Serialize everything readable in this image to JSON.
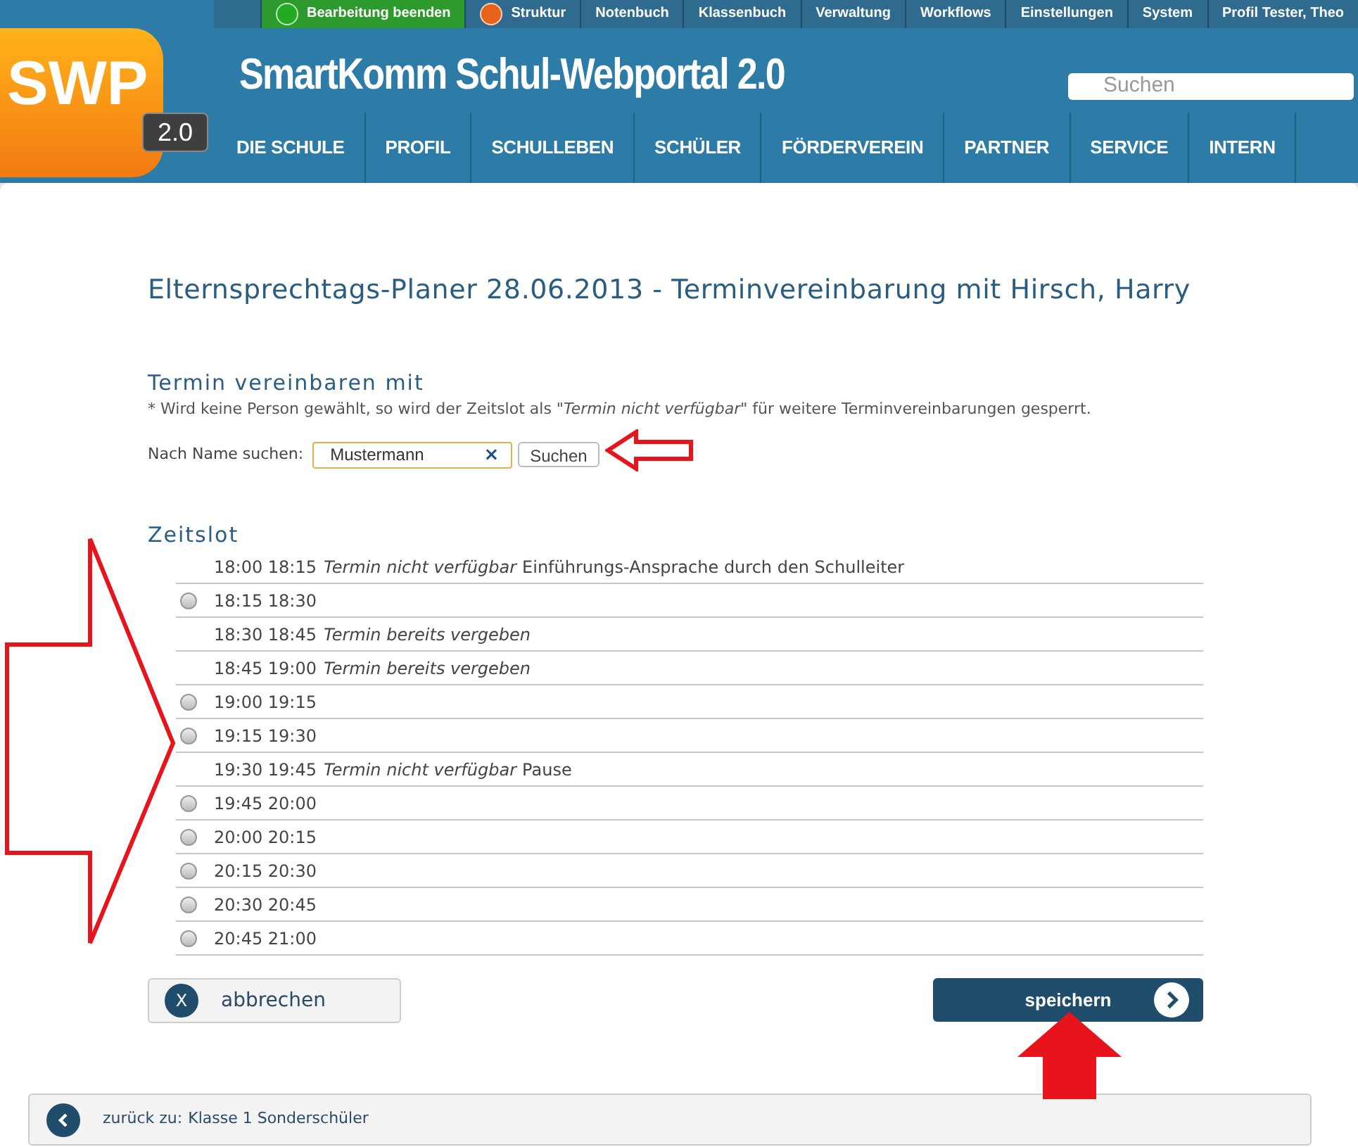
{
  "topbar": [
    {
      "label": "Bearbeitung beenden",
      "kind": "active",
      "color": "#22aa22"
    },
    {
      "label": "Struktur",
      "kind": "dot",
      "color": "#e8621a"
    },
    {
      "label": "Notenbuch",
      "kind": "plain"
    },
    {
      "label": "Klassenbuch",
      "kind": "plain"
    },
    {
      "label": "Verwaltung",
      "kind": "plain"
    },
    {
      "label": "Workflows",
      "kind": "plain"
    },
    {
      "label": "Einstellungen",
      "kind": "plain"
    },
    {
      "label": "System",
      "kind": "plain"
    },
    {
      "label": "Profil Tester, Theo",
      "kind": "plain"
    }
  ],
  "logo": {
    "text": "SWP",
    "version": "2.0"
  },
  "site_title": "SmartKomm Schul-Webportal 2.0",
  "search": {
    "placeholder": "Suchen"
  },
  "nav": [
    "DIE SCHULE",
    "PROFIL",
    "SCHULLEBEN",
    "SCHÜLER",
    "FÖRDERVEREIN",
    "PARTNER",
    "SERVICE",
    "INTERN"
  ],
  "page_title": "Elternsprechtags-Planer 28.06.2013 - Terminvereinbarung mit Hirsch, Harry",
  "appointment": {
    "heading": "Termin vereinbaren mit",
    "note": "* Wird keine Person gewählt, so wird der Zeitslot als \"*Termin nicht verfügbar*\" für weitere Terminvereinbarungen gesperrt.",
    "search_label": "Nach Name suchen:",
    "search_value": "Mustermann",
    "clear": "×",
    "search_button": "Suchen"
  },
  "timeslots": {
    "heading": "Zeitslot",
    "rows": [
      {
        "kind": "blocked",
        "time": "18:00 18:15",
        "status": "Termin nicht verfügbar",
        "note": "Einführungs-Ansprache durch den Schulleiter"
      },
      {
        "kind": "free",
        "time": "18:15 18:30",
        "selected": false
      },
      {
        "kind": "blocked",
        "time": "18:30 18:45",
        "status": "Termin bereits vergeben"
      },
      {
        "kind": "blocked",
        "time": "18:45 19:00",
        "status": "Termin bereits vergeben"
      },
      {
        "kind": "free",
        "time": "19:00 19:15",
        "selected": false
      },
      {
        "kind": "free",
        "time": "19:15 19:30",
        "selected": false
      },
      {
        "kind": "blocked",
        "time": "19:30 19:45",
        "status": "Termin nicht verfügbar",
        "note": "Pause"
      },
      {
        "kind": "free",
        "time": "19:45 20:00",
        "selected": false
      },
      {
        "kind": "free",
        "time": "20:00 20:15",
        "selected": false
      },
      {
        "kind": "free",
        "time": "20:15 20:30",
        "selected": false
      },
      {
        "kind": "free",
        "time": "20:30 20:45",
        "selected": false
      },
      {
        "kind": "free",
        "time": "20:45 21:00",
        "selected": false
      }
    ]
  },
  "cancel": {
    "icon": "X",
    "label": "abbrechen"
  },
  "save": {
    "label": "speichern"
  },
  "back": {
    "prefix": "zurück zu:",
    "link": "Klasse 1 Sonderschüler"
  }
}
